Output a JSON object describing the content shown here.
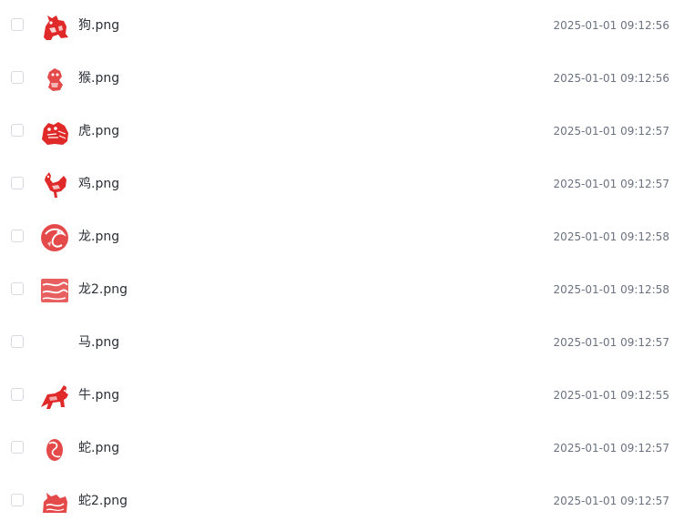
{
  "files": [
    {
      "name": "狗.png",
      "modified": "2025-01-01 09:12:56",
      "thumbnail": "papercut-dog-icon"
    },
    {
      "name": "猴.png",
      "modified": "2025-01-01 09:12:56",
      "thumbnail": "papercut-monkey-icon"
    },
    {
      "name": "虎.png",
      "modified": "2025-01-01 09:12:57",
      "thumbnail": "papercut-tiger-icon"
    },
    {
      "name": "鸡.png",
      "modified": "2025-01-01 09:12:57",
      "thumbnail": "papercut-rooster-icon"
    },
    {
      "name": "龙.png",
      "modified": "2025-01-01 09:12:58",
      "thumbnail": "papercut-dragon-icon"
    },
    {
      "name": "龙2.png",
      "modified": "2025-01-01 09:12:58",
      "thumbnail": "papercut-dragon-2-icon"
    },
    {
      "name": "马.png",
      "modified": "2025-01-01 09:12:57",
      "thumbnail": null
    },
    {
      "name": "牛.png",
      "modified": "2025-01-01 09:12:55",
      "thumbnail": "papercut-ox-icon"
    },
    {
      "name": "蛇.png",
      "modified": "2025-01-01 09:12:57",
      "thumbnail": "papercut-snake-icon"
    },
    {
      "name": "蛇2.png",
      "modified": "2025-01-01 09:12:57",
      "thumbnail": "papercut-snake-2-icon"
    }
  ],
  "colors": {
    "papercut_red": "#e02a2a",
    "text_primary": "#2b2f36",
    "text_secondary": "#6b7280",
    "checkbox_border": "#d6d9de"
  }
}
